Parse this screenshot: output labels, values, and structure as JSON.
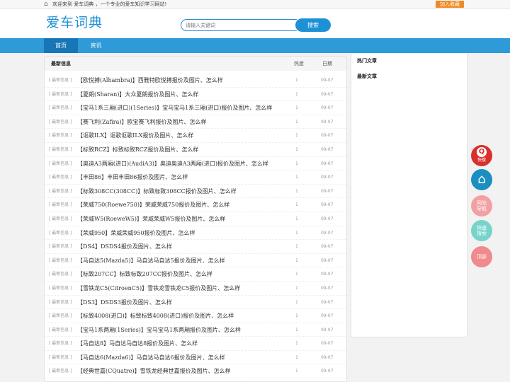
{
  "topbar": {
    "welcome": "欢迎来到 爱车词典 ，一个专业的爱车知识学习网站!",
    "fav": "加入收藏"
  },
  "header": {
    "logo": "爱车词典",
    "search_placeholder": "请输入关键词",
    "search_button": "搜索"
  },
  "nav": {
    "tabs": [
      {
        "label": "首页",
        "active": true
      },
      {
        "label": "资讯",
        "active": false
      }
    ]
  },
  "main": {
    "title": "最新信息",
    "col_heat": "热度",
    "col_date": "日期",
    "rows": [
      {
        "tag": "[ 最新信息 ]",
        "title": "【欧悦搏(Alhambra)】西雅特欧悦搏报价及图片、怎么样",
        "heat": "1",
        "date": "09-07"
      },
      {
        "tag": "[ 最新信息 ]",
        "title": "【夏朗(Sharan)】大众夏朗报价及图片、怎么样",
        "heat": "1",
        "date": "09-07"
      },
      {
        "tag": "[ 最新信息 ]",
        "title": "【宝马1系三厢(进口)(1Series)】宝马宝马1系三厢(进口)报价及图片、怎么样",
        "heat": "1",
        "date": "09-07"
      },
      {
        "tag": "[ 最新信息 ]",
        "title": "【赛飞利(Zafira)】欧宝赛飞利报价及图片、怎么样",
        "heat": "1",
        "date": "09-07"
      },
      {
        "tag": "[ 最新信息 ]",
        "title": "【讴歌ILX】讴歌讴歌ILX报价及图片、怎么样",
        "heat": "1",
        "date": "09-07"
      },
      {
        "tag": "[ 最新信息 ]",
        "title": "【标致RCZ】标致标致RCZ报价及图片、怎么样",
        "heat": "1",
        "date": "09-07"
      },
      {
        "tag": "[ 最新信息 ]",
        "title": "【奥迪A3两厢(进口)(AudiA3)】奥迪奥迪A3两厢(进口)报价及图片、怎么样",
        "heat": "1",
        "date": "09-07"
      },
      {
        "tag": "[ 最新信息 ]",
        "title": "【丰田86】丰田丰田86报价及图片、怎么样",
        "heat": "1",
        "date": "09-07"
      },
      {
        "tag": "[ 最新信息 ]",
        "title": "【标致308CC(308CC)】标致标致308CC报价及图片、怎么样",
        "heat": "1",
        "date": "09-07"
      },
      {
        "tag": "[ 最新信息 ]",
        "title": "【荣威750(Roewe750)】荣威荣威750报价及图片、怎么样",
        "heat": "1",
        "date": "09-07"
      },
      {
        "tag": "[ 最新信息 ]",
        "title": "【荣威W5(RoeweW5)】荣威荣威W5报价及图片、怎么样",
        "heat": "1",
        "date": "09-07"
      },
      {
        "tag": "[ 最新信息 ]",
        "title": "【荣威950】荣威荣威950报价及图片、怎么样",
        "heat": "1",
        "date": "09-07"
      },
      {
        "tag": "[ 最新信息 ]",
        "title": "【DS4】DSDS4报价及图片、怎么样",
        "heat": "1",
        "date": "09-07"
      },
      {
        "tag": "[ 最新信息 ]",
        "title": "【马自达5(Mazda5)】马自达马自达5报价及图片、怎么样",
        "heat": "1",
        "date": "09-07"
      },
      {
        "tag": "[ 最新信息 ]",
        "title": "【标致207CC】标致标致207CC报价及图片、怎么样",
        "heat": "1",
        "date": "09-07"
      },
      {
        "tag": "[ 最新信息 ]",
        "title": "【雪铁龙C5(CitroenC5)】雪铁龙雪铁龙C5报价及图片、怎么样",
        "heat": "1",
        "date": "09-07"
      },
      {
        "tag": "[ 最新信息 ]",
        "title": "【DS3】DSDS3报价及图片、怎么样",
        "heat": "1",
        "date": "09-07"
      },
      {
        "tag": "[ 最新信息 ]",
        "title": "【标致4008(进口)】标致标致4008(进口)报价及图片、怎么样",
        "heat": "1",
        "date": "09-07"
      },
      {
        "tag": "[ 最新信息 ]",
        "title": "【宝马1系两厢(1Series)】宝马宝马1系两厢报价及图片、怎么样",
        "heat": "1",
        "date": "09-07"
      },
      {
        "tag": "[ 最新信息 ]",
        "title": "【马自达8】马自达马自达8报价及图片、怎么样",
        "heat": "1",
        "date": "09-07"
      },
      {
        "tag": "[ 最新信息 ]",
        "title": "【马自达6(Mazda6)】马自达马自达6报价及图片、怎么样",
        "heat": "1",
        "date": "09-07"
      },
      {
        "tag": "[ 最新信息 ]",
        "title": "【经典世嘉(CQuatre)】雪铁龙经典世嘉报价及图片、怎么样",
        "heat": "1",
        "date": "09-07"
      }
    ]
  },
  "side": {
    "hot_title": "热门文章",
    "latest_title": "最新文章"
  },
  "float_buttons": {
    "quick_search": "快搜",
    "site_nav": [
      "网站",
      "导航"
    ],
    "fast_search": [
      "快速",
      "搜索"
    ],
    "top": "顶部"
  },
  "colors": {
    "brand": "#1e90d6",
    "nav": "#2e9ad8",
    "nav_active": "#1676b8",
    "fav": "#f08a24"
  }
}
